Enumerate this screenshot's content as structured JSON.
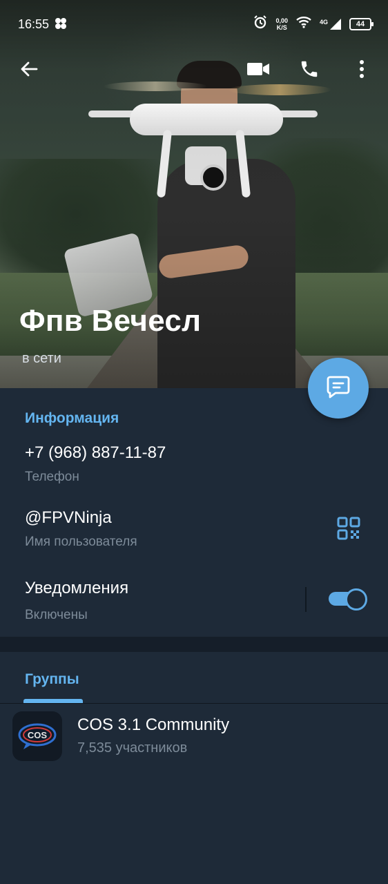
{
  "status_bar": {
    "time": "16:55",
    "net_speed_value": "0,00",
    "net_speed_unit": "K/S",
    "network": "4G",
    "battery": "44"
  },
  "profile": {
    "name": "Фпв Вечесл",
    "status": "в сети"
  },
  "info": {
    "section_title": "Информация",
    "phone": "+7 (968) 887-11-87",
    "phone_label": "Телефон",
    "username": "@FPVNinja",
    "username_label": "Имя пользователя",
    "notifications": "Уведомления",
    "notifications_state": "Включены",
    "notifications_enabled": true
  },
  "groups": {
    "tab_label": "Группы",
    "items": [
      {
        "name": "COS 3.1 Community",
        "members": "7,535 участников",
        "avatar_text": "COS"
      }
    ]
  },
  "icons": {
    "back": "arrow-left-icon",
    "video": "video-camera-icon",
    "call": "phone-icon",
    "menu": "more-vertical-icon",
    "message": "chat-icon",
    "qr": "qr-code-icon"
  },
  "colors": {
    "accent": "#5da9e4",
    "section_title": "#64b5f0",
    "background": "#1e2a38",
    "secondary_text": "#7d8b99"
  }
}
